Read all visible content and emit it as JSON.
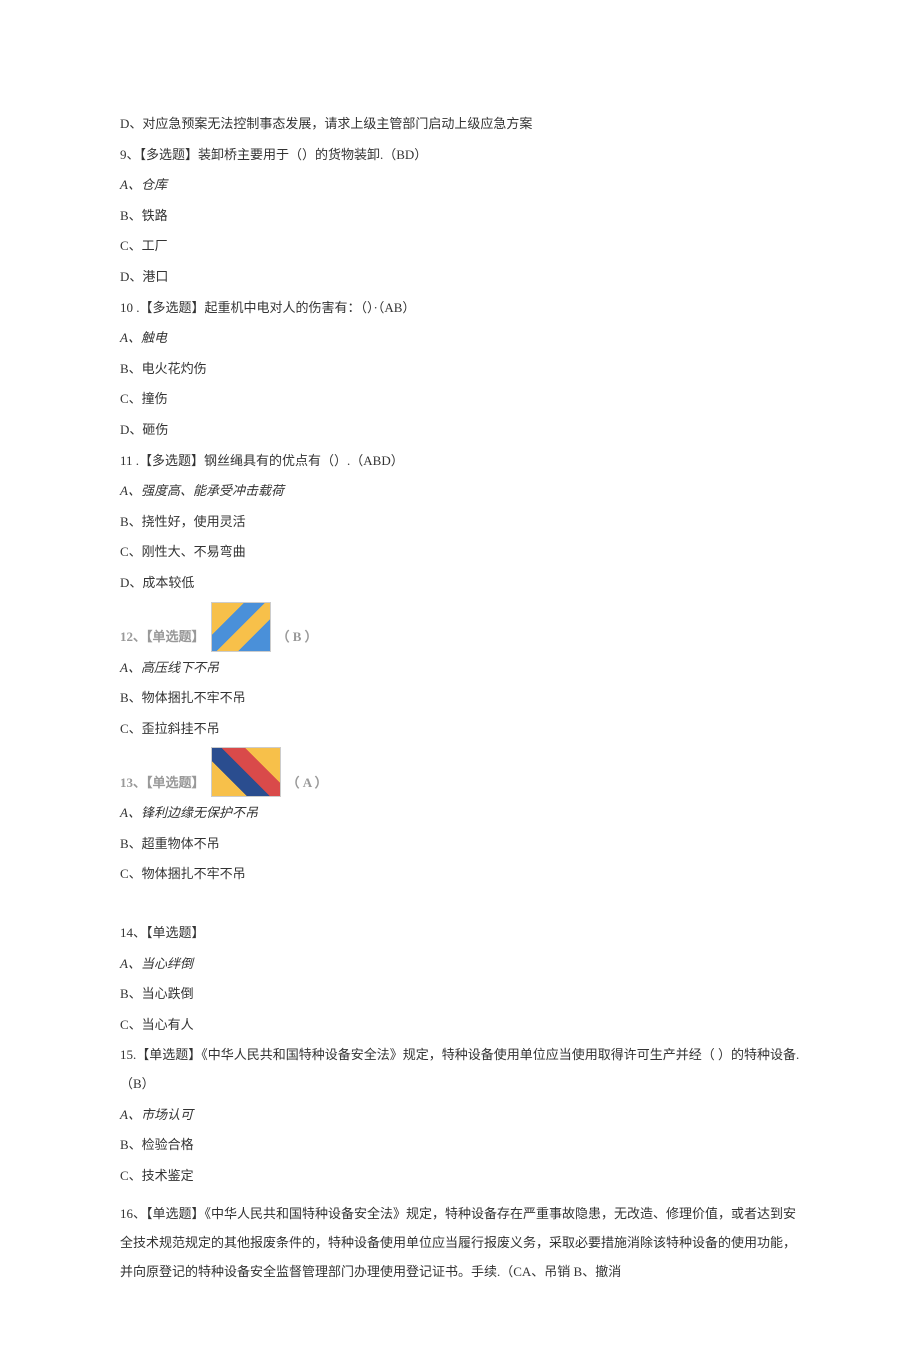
{
  "q8_d": "D、对应急预案无法控制事态发展，请求上级主管部门启动上级应急方案",
  "q9": {
    "stem": "9、【多选题】装卸桥主要用于（）的货物装卸.（BD）",
    "a": "A、仓库",
    "b": "B、铁路",
    "c": "C、工厂",
    "d": "D、港口"
  },
  "q10": {
    "stem": "10 .【多选题】起重机中电对人的伤害有：（）·（AB）",
    "a": "A、触电",
    "b": "B、电火花灼伤",
    "c": "C、撞伤",
    "d": "D、砸伤"
  },
  "q11": {
    "stem": "11 .【多选题】钢丝绳具有的优点有（）.（ABD）",
    "a": "A、强度高、能承受冲击载荷",
    "b": "B、挠性好，使用灵活",
    "c": "C、刚性大、不易弯曲",
    "d": "D、成本较低"
  },
  "q12": {
    "label": "12、【单选题】",
    "answer": "（  B  ）",
    "a": "A、高压线下不吊",
    "b": "B、物体捆扎不牢不吊",
    "c": "C、歪拉斜挂不吊"
  },
  "q13": {
    "label": "13、【单选题】",
    "answer": "（  A  ）",
    "a": "A、锋利边缘无保护不吊",
    "b": "B、超重物体不吊",
    "c": "C、物体捆扎不牢不吊"
  },
  "q14": {
    "stem": "14、【单选题】",
    "a": "A、当心绊倒",
    "b": "B、当心跌倒",
    "c": "C、当心有人"
  },
  "q15": {
    "stem": "15.【单选题】《中华人民共和国特种设备安全法》规定，特种设备使用单位应当使用取得许可生产并经（ ）的特种设备.（B）",
    "a": "A、市场认可",
    "b": "B、检验合格",
    "c": "C、技术鉴定"
  },
  "q16": {
    "stem": "16、【单选题】《中华人民共和国特种设备安全法》规定，特种设备存在严重事故隐患，无改造、修理价值，或者达到安全技术规范规定的其他报废条件的，特种设备使用单位应当履行报废义务，采取必要措施消除该特种设备的使用功能，并向原登记的特种设备安全监督管理部门办理使用登记证书。手续.（CA、吊销 B、撤消"
  }
}
